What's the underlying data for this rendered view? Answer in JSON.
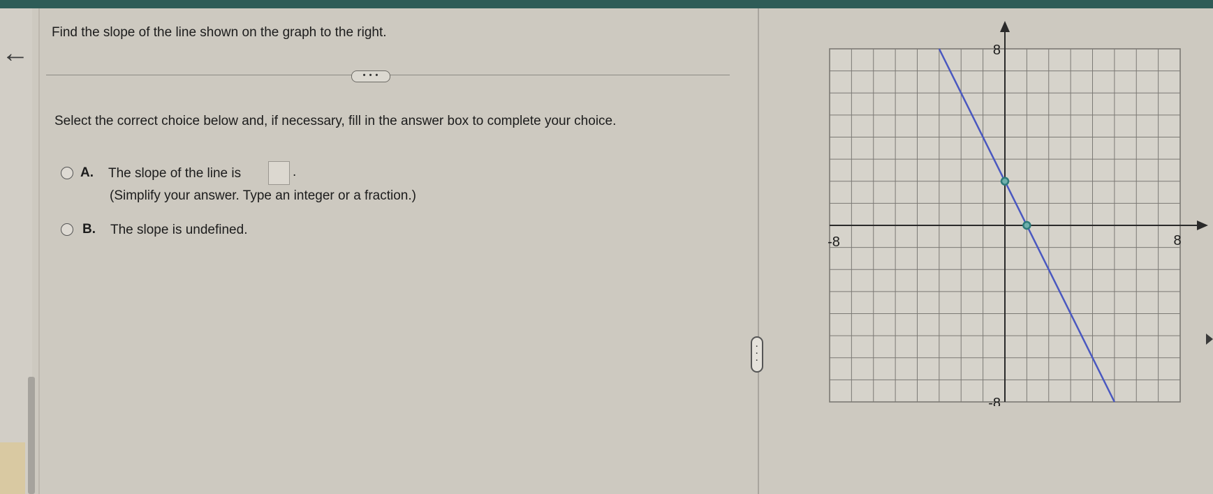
{
  "question": {
    "prompt": "Find the slope of the line shown on the graph to the right.",
    "more_button": "• • •",
    "instructions": "Select the correct choice below and, if necessary, fill in the answer box to complete your choice."
  },
  "choices": [
    {
      "letter": "A.",
      "text_before": "The slope of the line is",
      "answer_value": "",
      "text_after": ".",
      "hint": "(Simplify your answer. Type an integer or a fraction.)"
    },
    {
      "letter": "B.",
      "text": "The slope is undefined."
    }
  ],
  "graph": {
    "x_min_label": "-8",
    "x_max_label": "8",
    "y_max_label": "8",
    "y_min_label": "-8",
    "x_range": [
      -8,
      8
    ],
    "y_range": [
      -8,
      8
    ],
    "line_color": "#4a58c0",
    "point_color": "#2d7a7a",
    "line_endpoints": [
      [
        -3,
        8
      ],
      [
        5,
        -8
      ]
    ],
    "points": [
      [
        0,
        2
      ],
      [
        1,
        0
      ]
    ]
  },
  "colors": {
    "top_bar": "#2e5c57",
    "background": "#cdc9c0"
  },
  "icons": {
    "back": "left-arrow-icon",
    "splitter": "vertical-ellipsis-handle-icon"
  }
}
